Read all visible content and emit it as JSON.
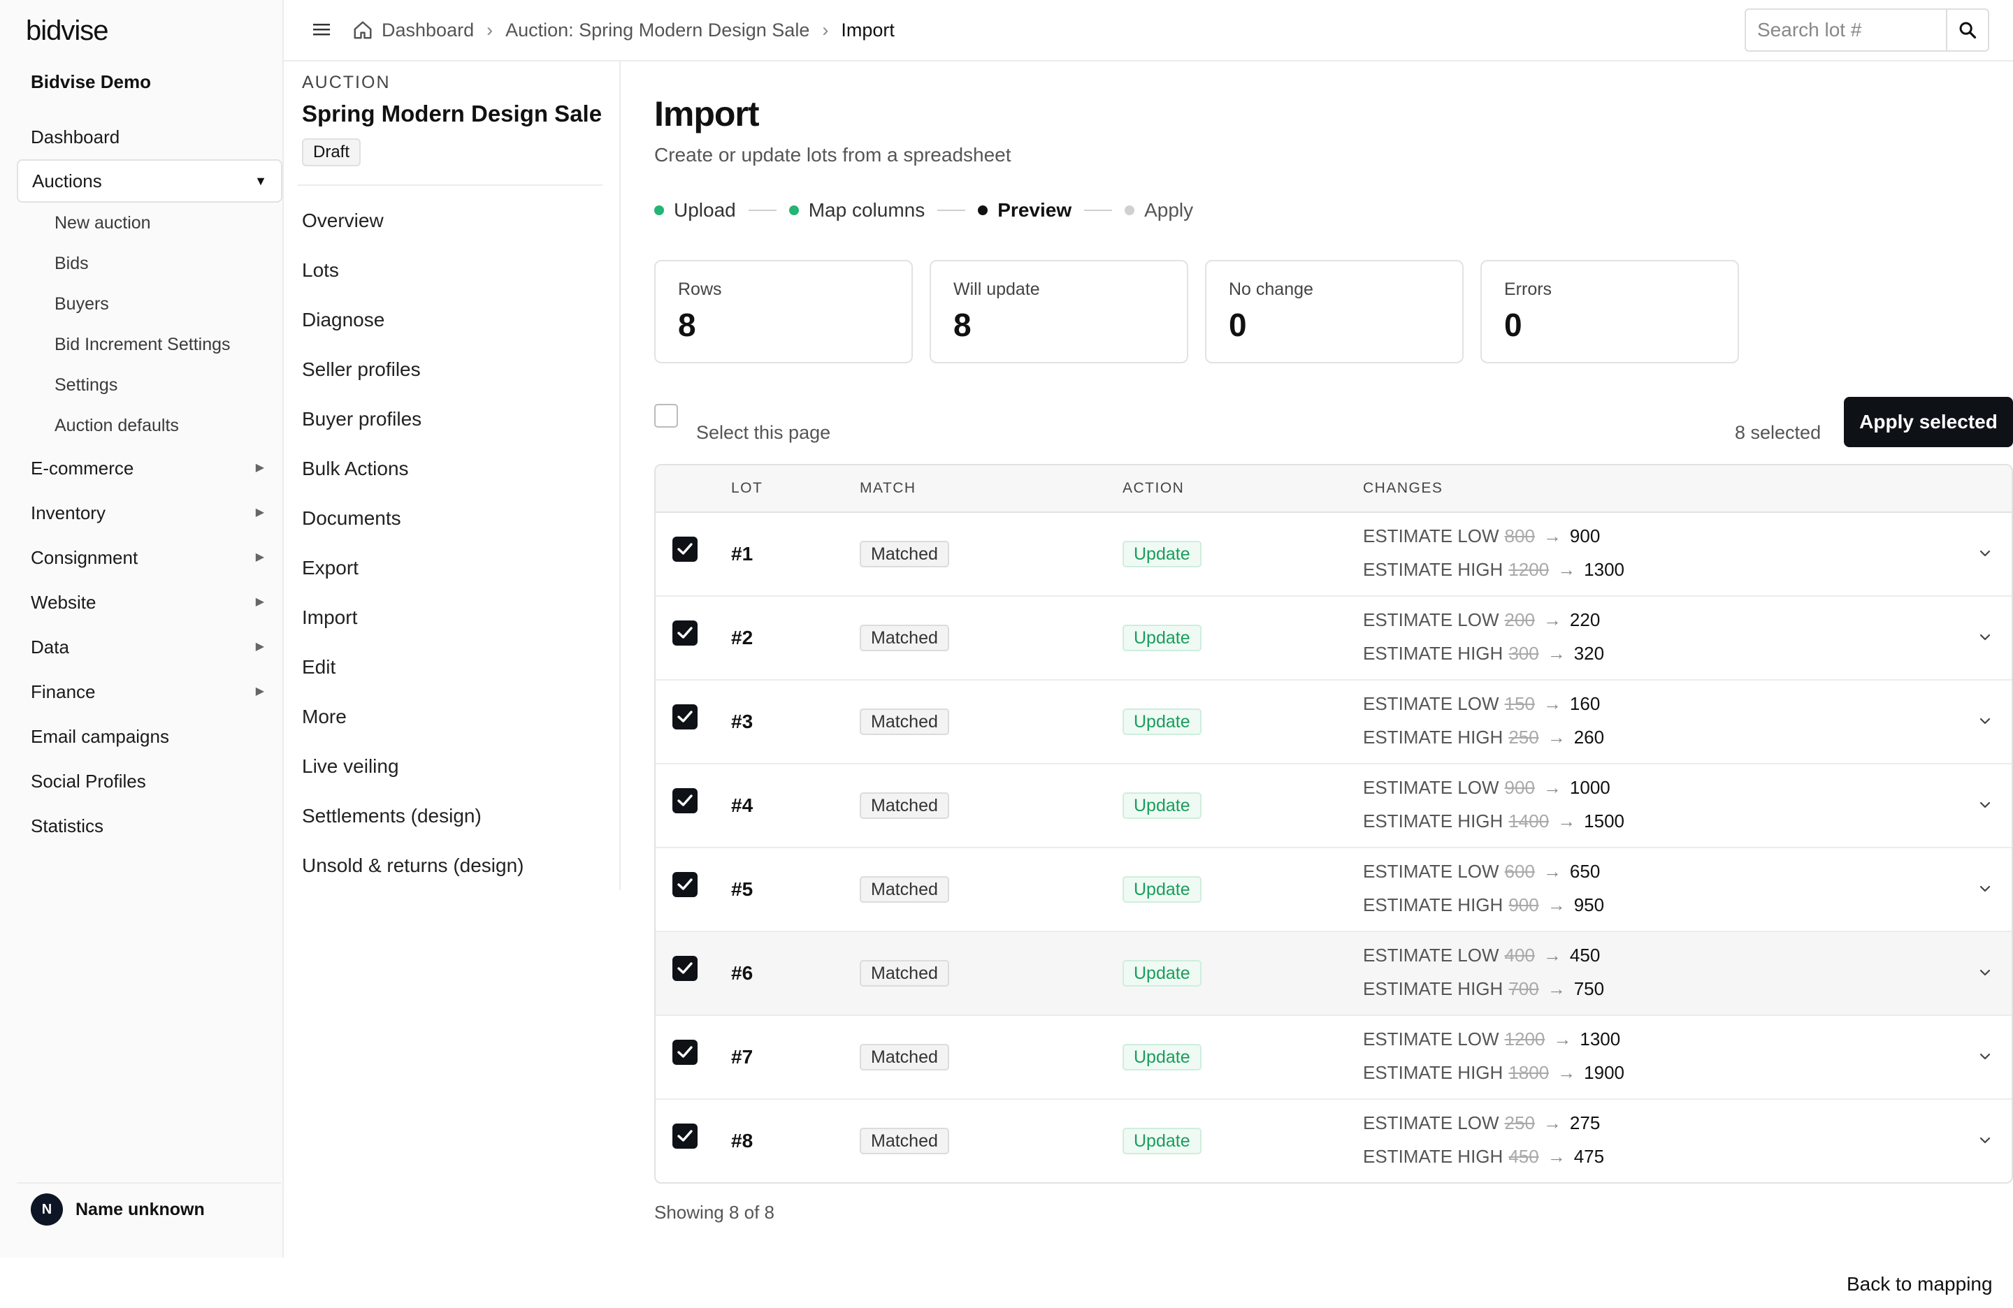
{
  "brand": {
    "logo": "bidvise",
    "org": "Bidvise Demo"
  },
  "sidebar": {
    "items": [
      {
        "label": "Dashboard"
      },
      {
        "label": "Auctions",
        "expanded": true,
        "children": [
          {
            "label": "New auction"
          },
          {
            "label": "Bids"
          },
          {
            "label": "Buyers"
          },
          {
            "label": "Bid Increment Settings"
          },
          {
            "label": "Settings"
          },
          {
            "label": "Auction defaults"
          }
        ]
      },
      {
        "label": "E-commerce"
      },
      {
        "label": "Inventory"
      },
      {
        "label": "Consignment"
      },
      {
        "label": "Website"
      },
      {
        "label": "Data"
      },
      {
        "label": "Finance"
      },
      {
        "label": "Email campaigns"
      },
      {
        "label": "Social Profiles"
      },
      {
        "label": "Statistics"
      }
    ],
    "user": {
      "initial": "N",
      "name": "Name unknown"
    }
  },
  "topbar": {
    "breadcrumb": [
      "Dashboard",
      "Auction: Spring Modern Design Sale",
      "Import"
    ],
    "search_placeholder": "Search lot #"
  },
  "auction": {
    "kicker": "AUCTION",
    "title": "Spring Modern Design Sale",
    "status": "Draft",
    "nav": [
      "Overview",
      "Lots",
      "Diagnose",
      "Seller profiles",
      "Buyer profiles",
      "Bulk Actions",
      "Documents",
      "Export",
      "Import",
      "Edit",
      "More",
      "Live veiling",
      "Settlements (design)",
      "Unsold & returns (design)"
    ]
  },
  "main": {
    "title": "Import",
    "subtitle": "Create or update lots from a spreadsheet",
    "steps": [
      {
        "label": "Upload",
        "state": "done"
      },
      {
        "label": "Map columns",
        "state": "done"
      },
      {
        "label": "Preview",
        "state": "current"
      },
      {
        "label": "Apply",
        "state": "todo"
      }
    ],
    "stats": [
      {
        "label": "Rows",
        "value": "8"
      },
      {
        "label": "Will update",
        "value": "8"
      },
      {
        "label": "No change",
        "value": "0"
      },
      {
        "label": "Errors",
        "value": "0"
      }
    ],
    "select_page_label": "Select this page",
    "selected_count": "8 selected",
    "apply_button": "Apply selected",
    "table": {
      "columns": [
        "LOT",
        "MATCH",
        "ACTION",
        "CHANGES"
      ],
      "field_low": "ESTIMATE LOW",
      "field_high": "ESTIMATE HIGH",
      "arrow": "→",
      "rows": [
        {
          "lot": "#1",
          "match": "Matched",
          "action": "Update",
          "low_old": "800",
          "low_new": "900",
          "high_old": "1200",
          "high_new": "1300",
          "checked": true
        },
        {
          "lot": "#2",
          "match": "Matched",
          "action": "Update",
          "low_old": "200",
          "low_new": "220",
          "high_old": "300",
          "high_new": "320",
          "checked": true
        },
        {
          "lot": "#3",
          "match": "Matched",
          "action": "Update",
          "low_old": "150",
          "low_new": "160",
          "high_old": "250",
          "high_new": "260",
          "checked": true
        },
        {
          "lot": "#4",
          "match": "Matched",
          "action": "Update",
          "low_old": "900",
          "low_new": "1000",
          "high_old": "1400",
          "high_new": "1500",
          "checked": true
        },
        {
          "lot": "#5",
          "match": "Matched",
          "action": "Update",
          "low_old": "600",
          "low_new": "650",
          "high_old": "900",
          "high_new": "950",
          "checked": true
        },
        {
          "lot": "#6",
          "match": "Matched",
          "action": "Update",
          "low_old": "400",
          "low_new": "450",
          "high_old": "700",
          "high_new": "750",
          "checked": true
        },
        {
          "lot": "#7",
          "match": "Matched",
          "action": "Update",
          "low_old": "1200",
          "low_new": "1300",
          "high_old": "1800",
          "high_new": "1900",
          "checked": true
        },
        {
          "lot": "#8",
          "match": "Matched",
          "action": "Update",
          "low_old": "250",
          "low_new": "275",
          "high_old": "450",
          "high_new": "475",
          "checked": true
        }
      ]
    },
    "showing": "Showing 8 of 8",
    "back_link": "Back to mapping"
  },
  "colors": {
    "accent_dark": "#0e1116",
    "success": "#1a9d5c",
    "step_done": "#22b573"
  }
}
